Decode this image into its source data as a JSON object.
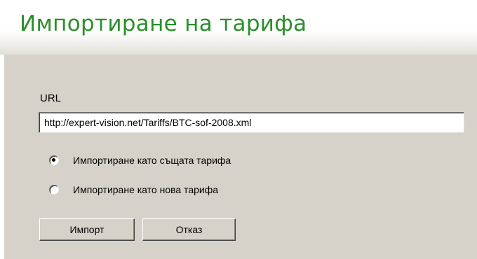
{
  "header": {
    "title": "Импортиране на тарифа"
  },
  "form": {
    "url_label": "URL",
    "url_value": "http://expert-vision.net/Tariffs/BTC-sof-2008.xml",
    "options": [
      {
        "label": "Импортиране като същата тарифа",
        "checked": true
      },
      {
        "label": "Импортиране като нова тарифа",
        "checked": false
      }
    ],
    "buttons": {
      "import": "Импорт",
      "cancel": "Отказ"
    }
  },
  "colors": {
    "title": "#2a8f2a",
    "panel": "#d6d2ca"
  }
}
